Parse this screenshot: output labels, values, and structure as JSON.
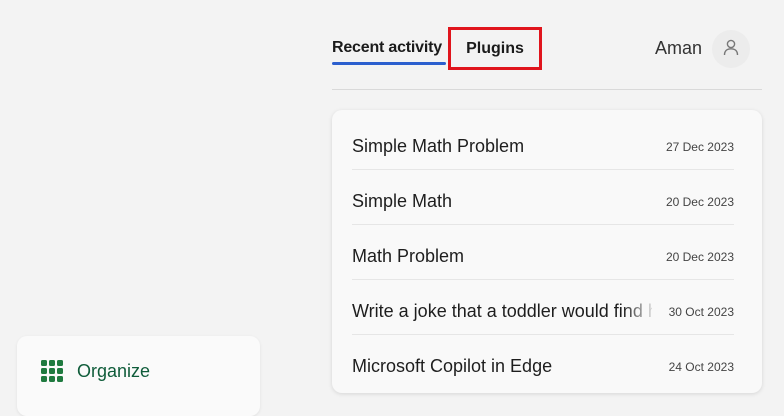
{
  "header": {
    "tabs": [
      {
        "label": "Recent activity",
        "active": true
      },
      {
        "label": "Plugins",
        "active": false,
        "highlighted": true
      }
    ],
    "user": {
      "name": "Aman",
      "avatar_icon": "person-icon"
    }
  },
  "activity": {
    "items": [
      {
        "title": "Simple Math Problem",
        "date": "27 Dec 2023"
      },
      {
        "title": "Simple Math",
        "date": "20 Dec 2023"
      },
      {
        "title": "Math Problem",
        "date": "20 Dec 2023"
      },
      {
        "title": "Write a joke that a toddler would find hil",
        "date": "30 Oct 2023"
      },
      {
        "title": "Microsoft Copilot in Edge",
        "date": "24 Oct 2023"
      }
    ]
  },
  "sidebar": {
    "organize": {
      "label": "Organize",
      "icon": "grid-icon"
    }
  },
  "colors": {
    "active_tab_underline": "#2b5fce",
    "highlight_box": "#e0141c",
    "organize_icon": "#1f7a3f"
  }
}
